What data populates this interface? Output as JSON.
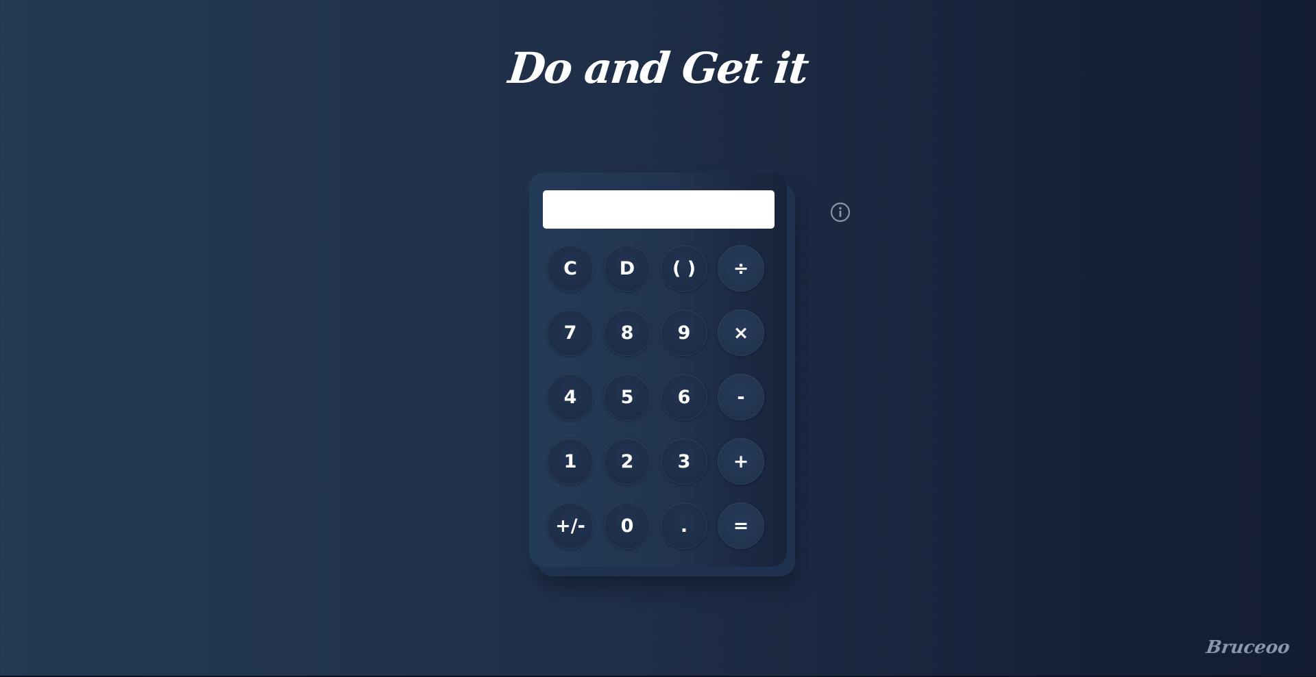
{
  "page": {
    "title": "Do and Get it",
    "brand": "Bruceoo"
  },
  "display": {
    "value": ""
  },
  "keys": [
    {
      "label": "C",
      "name": "clear"
    },
    {
      "label": "D",
      "name": "delete"
    },
    {
      "label": "( )",
      "name": "parentheses"
    },
    {
      "label": "÷",
      "name": "divide"
    },
    {
      "label": "7",
      "name": "seven"
    },
    {
      "label": "8",
      "name": "eight"
    },
    {
      "label": "9",
      "name": "nine"
    },
    {
      "label": "×",
      "name": "multiply"
    },
    {
      "label": "4",
      "name": "four"
    },
    {
      "label": "5",
      "name": "five"
    },
    {
      "label": "6",
      "name": "six"
    },
    {
      "label": "-",
      "name": "subtract"
    },
    {
      "label": "1",
      "name": "one"
    },
    {
      "label": "2",
      "name": "two"
    },
    {
      "label": "3",
      "name": "three"
    },
    {
      "label": "+",
      "name": "add"
    },
    {
      "label": "+/-",
      "name": "negate"
    },
    {
      "label": "0",
      "name": "zero"
    },
    {
      "label": ".",
      "name": "decimal"
    },
    {
      "label": "=",
      "name": "equals"
    }
  ],
  "icons": {
    "info": "info-circle-icon"
  },
  "colors": {
    "background_start": "#243953",
    "background_end": "#141d31",
    "display_bg": "#ffffff",
    "key_text": "#ffffff",
    "icon_gray": "#8a95a8"
  }
}
